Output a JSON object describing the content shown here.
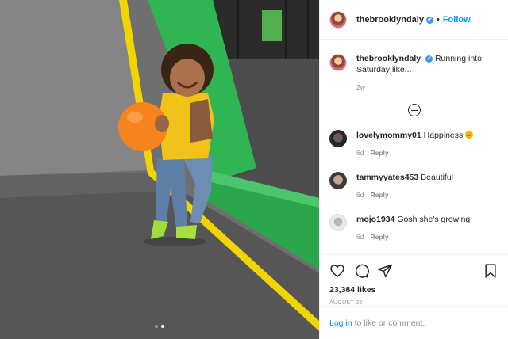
{
  "post": {
    "username": "thebrooklyndaly",
    "verified_mark": "✔",
    "separator": "•",
    "follow_label": "Follow",
    "caption": "Running into Saturday like...",
    "caption_age": "2w"
  },
  "comments": [
    {
      "username": "lovelymommy01",
      "text": "Happiness",
      "emoji": "smiling-face-with-hearts",
      "age": "6d",
      "reply_label": "Reply"
    },
    {
      "username": "tammyyates453",
      "text": "Beautiful",
      "age": "6d",
      "reply_label": "Reply"
    },
    {
      "username": "mojo1934",
      "text": "Gosh she's growing",
      "age": "6d",
      "reply_label": "Reply"
    }
  ],
  "stats": {
    "likes": "23,384 likes",
    "date": "AUGUST 22"
  },
  "login": {
    "link_label": "Log in",
    "suffix": "to like or comment."
  },
  "carousel": {
    "count": 2,
    "active_index": 1
  },
  "icons": [
    "heart-icon",
    "comment-icon",
    "share-icon",
    "bookmark-icon",
    "load-more-icon"
  ],
  "colors": {
    "accent": "#0095f6",
    "verified": "#3897f0",
    "trampoline_pad": "#27ae4f",
    "edge_stripe": "#f2d500",
    "ball": "#f5841f"
  }
}
